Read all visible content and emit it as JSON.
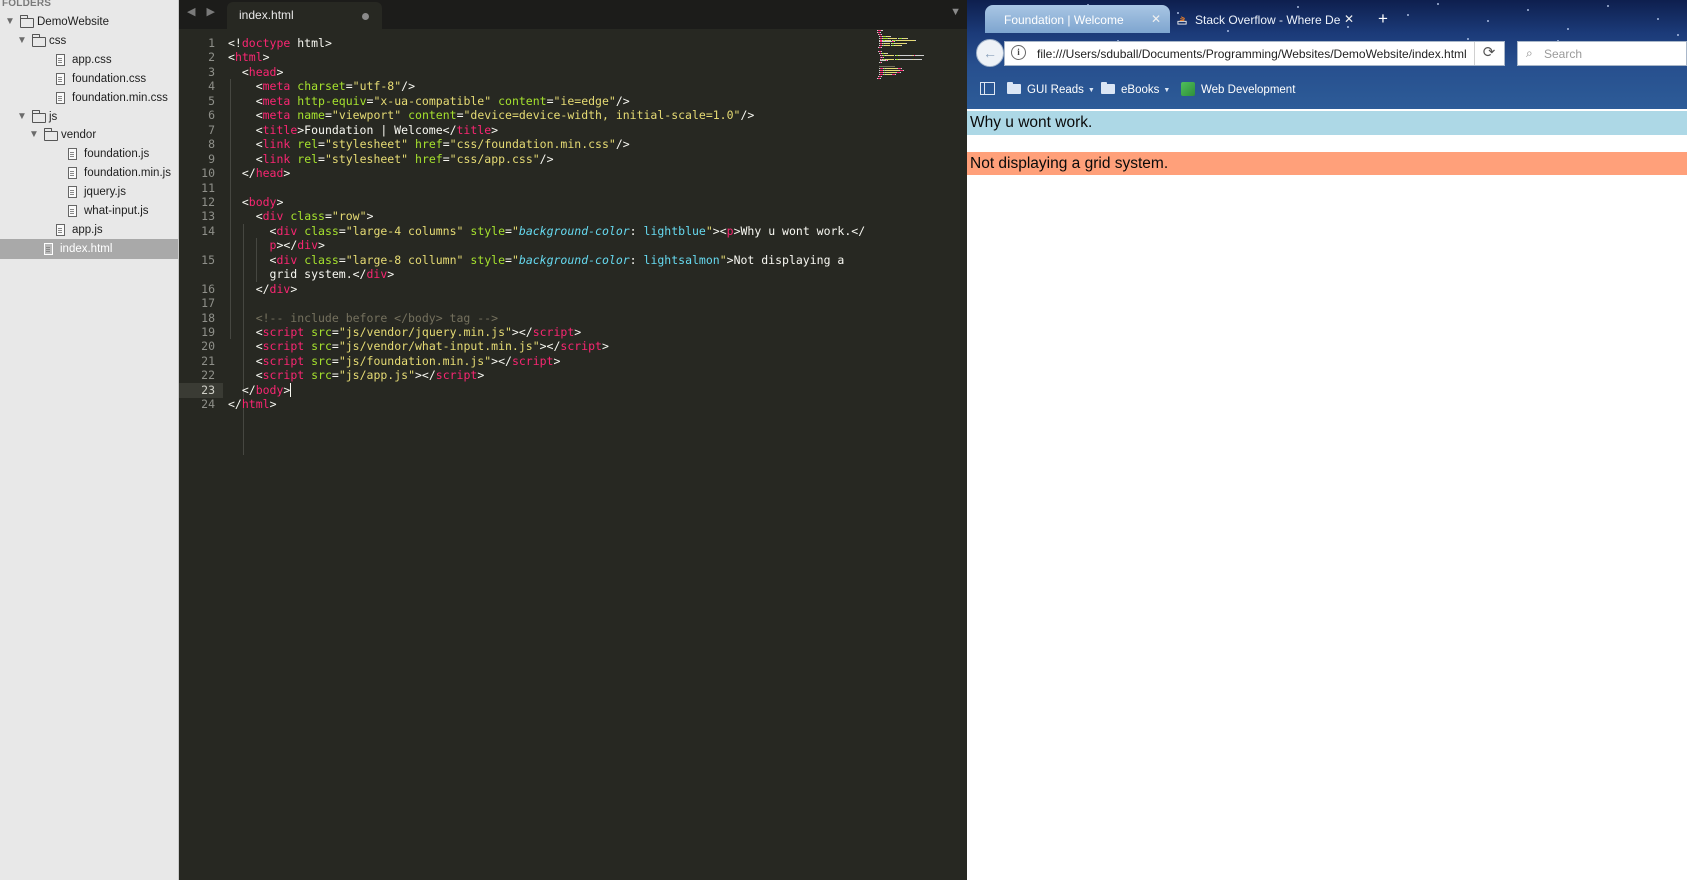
{
  "sidebar": {
    "title": "FOLDERS",
    "items": [
      {
        "label": "DemoWebsite",
        "type": "folder",
        "depth": 0,
        "expanded": true
      },
      {
        "label": "css",
        "type": "folder",
        "depth": 1,
        "expanded": true
      },
      {
        "label": "app.css",
        "type": "file",
        "depth": 2
      },
      {
        "label": "foundation.css",
        "type": "file",
        "depth": 2
      },
      {
        "label": "foundation.min.css",
        "type": "file",
        "depth": 2
      },
      {
        "label": "js",
        "type": "folder",
        "depth": 1,
        "expanded": true
      },
      {
        "label": "vendor",
        "type": "folder",
        "depth": 2,
        "expanded": true
      },
      {
        "label": "foundation.js",
        "type": "file",
        "depth": 3
      },
      {
        "label": "foundation.min.js",
        "type": "file",
        "depth": 3
      },
      {
        "label": "jquery.js",
        "type": "file",
        "depth": 3
      },
      {
        "label": "what-input.js",
        "type": "file",
        "depth": 3
      },
      {
        "label": "app.js",
        "type": "file",
        "depth": 2
      },
      {
        "label": "index.html",
        "type": "file",
        "depth": 1,
        "selected": true
      }
    ]
  },
  "editor": {
    "tab_label": "index.html",
    "active_line": 23,
    "line_numbers": [
      "1",
      "2",
      "3",
      "4",
      "5",
      "6",
      "7",
      "8",
      "9",
      "10",
      "11",
      "12",
      "13",
      "14",
      "",
      "15",
      "",
      "16",
      "17",
      "18",
      "19",
      "20",
      "21",
      "22",
      "23",
      "24"
    ],
    "code_lines": [
      [
        [
          "p",
          "<!"
        ],
        [
          "tag",
          "doctype"
        ],
        [
          "p",
          " html>"
        ]
      ],
      [
        [
          "p",
          "<"
        ],
        [
          "tag",
          "html"
        ],
        [
          "p",
          ">"
        ]
      ],
      [
        [
          "p",
          "  <"
        ],
        [
          "tag",
          "head"
        ],
        [
          "p",
          ">"
        ]
      ],
      [
        [
          "p",
          "    <"
        ],
        [
          "tag",
          "meta"
        ],
        [
          "p",
          " "
        ],
        [
          "attr",
          "charset"
        ],
        [
          "p",
          "="
        ],
        [
          "str",
          "\"utf-8\""
        ],
        [
          "p",
          "/>"
        ]
      ],
      [
        [
          "p",
          "    <"
        ],
        [
          "tag",
          "meta"
        ],
        [
          "p",
          " "
        ],
        [
          "attr",
          "http-equiv"
        ],
        [
          "p",
          "="
        ],
        [
          "str",
          "\"x-ua-compatible\""
        ],
        [
          "p",
          " "
        ],
        [
          "attr",
          "content"
        ],
        [
          "p",
          "="
        ],
        [
          "str",
          "\"ie=edge\""
        ],
        [
          "p",
          "/>"
        ]
      ],
      [
        [
          "p",
          "    <"
        ],
        [
          "tag",
          "meta"
        ],
        [
          "p",
          " "
        ],
        [
          "attr",
          "name"
        ],
        [
          "p",
          "="
        ],
        [
          "str",
          "\"viewport\""
        ],
        [
          "p",
          " "
        ],
        [
          "attr",
          "content"
        ],
        [
          "p",
          "="
        ],
        [
          "str",
          "\"device=device-width, initial-scale=1.0\""
        ],
        [
          "p",
          "/>"
        ]
      ],
      [
        [
          "p",
          "    <"
        ],
        [
          "tag",
          "title"
        ],
        [
          "p",
          ">Foundation | Welcome</"
        ],
        [
          "tag",
          "title"
        ],
        [
          "p",
          ">"
        ]
      ],
      [
        [
          "p",
          "    <"
        ],
        [
          "tag",
          "link"
        ],
        [
          "p",
          " "
        ],
        [
          "attr",
          "rel"
        ],
        [
          "p",
          "="
        ],
        [
          "str",
          "\"stylesheet\""
        ],
        [
          "p",
          " "
        ],
        [
          "attr",
          "href"
        ],
        [
          "p",
          "="
        ],
        [
          "str",
          "\"css/foundation.min.css\""
        ],
        [
          "p",
          "/>"
        ]
      ],
      [
        [
          "p",
          "    <"
        ],
        [
          "tag",
          "link"
        ],
        [
          "p",
          " "
        ],
        [
          "attr",
          "rel"
        ],
        [
          "p",
          "="
        ],
        [
          "str",
          "\"stylesheet\""
        ],
        [
          "p",
          " "
        ],
        [
          "attr",
          "href"
        ],
        [
          "p",
          "="
        ],
        [
          "str",
          "\"css/app.css\""
        ],
        [
          "p",
          "/>"
        ]
      ],
      [
        [
          "p",
          "  </"
        ],
        [
          "tag",
          "head"
        ],
        [
          "p",
          ">"
        ]
      ],
      [],
      [
        [
          "p",
          "  <"
        ],
        [
          "tag",
          "body"
        ],
        [
          "p",
          ">"
        ]
      ],
      [
        [
          "p",
          "    <"
        ],
        [
          "tag",
          "div"
        ],
        [
          "p",
          " "
        ],
        [
          "attr",
          "class"
        ],
        [
          "p",
          "="
        ],
        [
          "str",
          "\"row\""
        ],
        [
          "p",
          ">"
        ]
      ],
      [
        [
          "p",
          "      <"
        ],
        [
          "tag",
          "div"
        ],
        [
          "p",
          " "
        ],
        [
          "attr",
          "class"
        ],
        [
          "p",
          "="
        ],
        [
          "str",
          "\"large-4 columns\""
        ],
        [
          "p",
          " "
        ],
        [
          "attr",
          "style"
        ],
        [
          "p",
          "="
        ],
        [
          "str",
          "\""
        ],
        [
          "prop",
          "background-color"
        ],
        [
          "p",
          ": "
        ],
        [
          "val",
          "lightblue"
        ],
        [
          "str",
          "\""
        ],
        [
          "p",
          "><"
        ],
        [
          "tag",
          "p"
        ],
        [
          "p",
          ">Why u wont work.</"
        ]
      ],
      [
        [
          "tag",
          "      p"
        ],
        [
          "p",
          "></"
        ],
        [
          "tag",
          "div"
        ],
        [
          "p",
          ">"
        ]
      ],
      [
        [
          "p",
          "      <"
        ],
        [
          "tag",
          "div"
        ],
        [
          "p",
          " "
        ],
        [
          "attr",
          "class"
        ],
        [
          "p",
          "="
        ],
        [
          "str",
          "\"large-8 collumn\""
        ],
        [
          "p",
          " "
        ],
        [
          "attr",
          "style"
        ],
        [
          "p",
          "="
        ],
        [
          "str",
          "\""
        ],
        [
          "prop",
          "background-color"
        ],
        [
          "p",
          ": "
        ],
        [
          "val",
          "lightsalmon"
        ],
        [
          "str",
          "\""
        ],
        [
          "p",
          ">Not displaying a"
        ]
      ],
      [
        [
          "p",
          "      grid system.</"
        ],
        [
          "tag",
          "div"
        ],
        [
          "p",
          ">"
        ]
      ],
      [
        [
          "p",
          "    </"
        ],
        [
          "tag",
          "div"
        ],
        [
          "p",
          ">"
        ]
      ],
      [],
      [
        [
          "com",
          "    <!-- include before </body> tag -->"
        ]
      ],
      [
        [
          "p",
          "    <"
        ],
        [
          "tag",
          "script"
        ],
        [
          "p",
          " "
        ],
        [
          "attr",
          "src"
        ],
        [
          "p",
          "="
        ],
        [
          "str",
          "\"js/vendor/jquery.min.js\""
        ],
        [
          "p",
          "></"
        ],
        [
          "tag",
          "script"
        ],
        [
          "p",
          ">"
        ]
      ],
      [
        [
          "p",
          "    <"
        ],
        [
          "tag",
          "script"
        ],
        [
          "p",
          " "
        ],
        [
          "attr",
          "src"
        ],
        [
          "p",
          "="
        ],
        [
          "str",
          "\"js/vendor/what-input.min.js\""
        ],
        [
          "p",
          "></"
        ],
        [
          "tag",
          "script"
        ],
        [
          "p",
          ">"
        ]
      ],
      [
        [
          "p",
          "    <"
        ],
        [
          "tag",
          "script"
        ],
        [
          "p",
          " "
        ],
        [
          "attr",
          "src"
        ],
        [
          "p",
          "="
        ],
        [
          "str",
          "\"js/foundation.min.js\""
        ],
        [
          "p",
          "></"
        ],
        [
          "tag",
          "script"
        ],
        [
          "p",
          ">"
        ]
      ],
      [
        [
          "p",
          "    <"
        ],
        [
          "tag",
          "script"
        ],
        [
          "p",
          " "
        ],
        [
          "attr",
          "src"
        ],
        [
          "p",
          "="
        ],
        [
          "str",
          "\"js/app.js\""
        ],
        [
          "p",
          "></"
        ],
        [
          "tag",
          "script"
        ],
        [
          "p",
          ">"
        ]
      ],
      [
        [
          "p",
          "  </"
        ],
        [
          "tag",
          "body"
        ],
        [
          "p",
          ">"
        ],
        [
          "caret",
          ""
        ]
      ],
      [
        [
          "p",
          "</"
        ],
        [
          "tag",
          "html"
        ],
        [
          "p",
          ">"
        ]
      ]
    ]
  },
  "browser": {
    "tabs": [
      {
        "title": "Foundation | Welcome",
        "active": true
      },
      {
        "title": "Stack Overflow - Where Developers Learn, Share, & Build Careers",
        "active": false
      }
    ],
    "new_tab": "+",
    "url": "file:///Users/sduball/Documents/Programming/Websites/DemoWebsite/index.html",
    "search_placeholder": "Search",
    "bookmarks": [
      {
        "label": "GUI Reads",
        "type": "folder"
      },
      {
        "label": "eBooks",
        "type": "folder"
      },
      {
        "label": "Web Development",
        "type": "link"
      }
    ],
    "content": {
      "col1_text": "Why u wont work.",
      "col2_text": "Not displaying a grid system.",
      "col1_color": "lightblue",
      "col2_color": "lightsalmon"
    }
  },
  "colors": {
    "editor_bg": "#272822",
    "tag": "#f92672",
    "attr": "#a6e22e",
    "string": "#e6db74",
    "property": "#66d9ef",
    "comment": "#75715e"
  }
}
